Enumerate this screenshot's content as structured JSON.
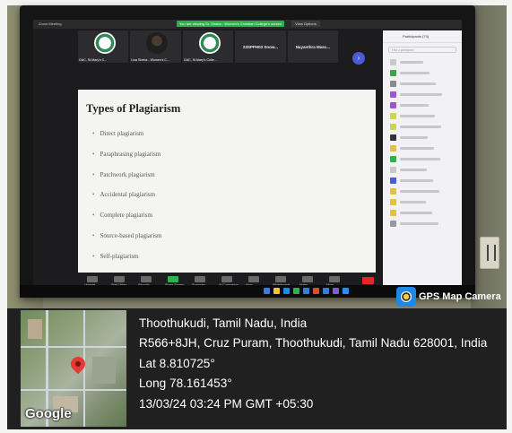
{
  "zoom": {
    "window_title": "Zoom Meeting",
    "share_banner": "You are viewing Sr. Shoba - Women's Christian College's screen",
    "view_options": "View Options",
    "thumbnails": [
      {
        "label": "GAC, St.Mary's C...",
        "kind": "logo"
      },
      {
        "label": "Lisa Sheba - Women's C...",
        "kind": "person"
      },
      {
        "label": "GAC, St.Mary's Colle...",
        "kind": "logo"
      },
      {
        "label": "23SPPH03 Snow...",
        "kind": "text"
      },
      {
        "label": "Nayanthra Masc...",
        "kind": "text"
      }
    ],
    "slide": {
      "title": "Types of Plagiarism",
      "bullets": [
        "Direct plagiarism",
        "Paraphrasing plagiarism",
        "Patchwork plagiarism",
        "Accidental plagiarism",
        "Complete plagiarism",
        "Source-based plagiarism",
        "Self-plagiarism"
      ]
    },
    "participants": {
      "title": "Participants (74)",
      "search_placeholder": "Find a participant",
      "avatar_colors": [
        "#c9c9c9",
        "#3fa34d",
        "#8a8a8a",
        "#9b59d0",
        "#9b59d0",
        "#c8d84a",
        "#c8d84a",
        "#333333",
        "#e0c43a",
        "#2bb24c",
        "#c8c8c8",
        "#4a5cd8",
        "#e0c43a",
        "#e0c43a",
        "#e0c43a",
        "#999999"
      ]
    },
    "toolbar": [
      {
        "label": "Unmute",
        "icon": "mic-muted-icon"
      },
      {
        "label": "Start Video",
        "icon": "video-off-icon"
      },
      {
        "label": "Security",
        "icon": "shield-icon"
      },
      {
        "label": "Share Screen",
        "icon": "share-screen-icon",
        "accent": "#2bb24c"
      },
      {
        "label": "Summary",
        "icon": "summary-icon"
      },
      {
        "label": "AI Companion",
        "icon": "ai-companion-icon"
      },
      {
        "label": "Apps",
        "icon": "apps-icon"
      },
      {
        "label": "Whiteboards",
        "icon": "whiteboard-icon"
      },
      {
        "label": "Notes",
        "icon": "notes-icon"
      },
      {
        "label": "More",
        "icon": "more-icon"
      }
    ],
    "end_color": "#e02828"
  },
  "gps_badge": {
    "text": "GPS Map Camera",
    "icon": "gps-map-camera-icon"
  },
  "geo": {
    "place": "Thoothukudi, Tamil Nadu, India",
    "address": "R566+8JH, Cruz Puram, Thoothukudi, Tamil Nadu 628001, India",
    "lat": "Lat 8.810725°",
    "long": "Long 78.161453°",
    "timestamp": "13/03/24 03:24 PM GMT +05:30",
    "map_brand": "Google"
  }
}
